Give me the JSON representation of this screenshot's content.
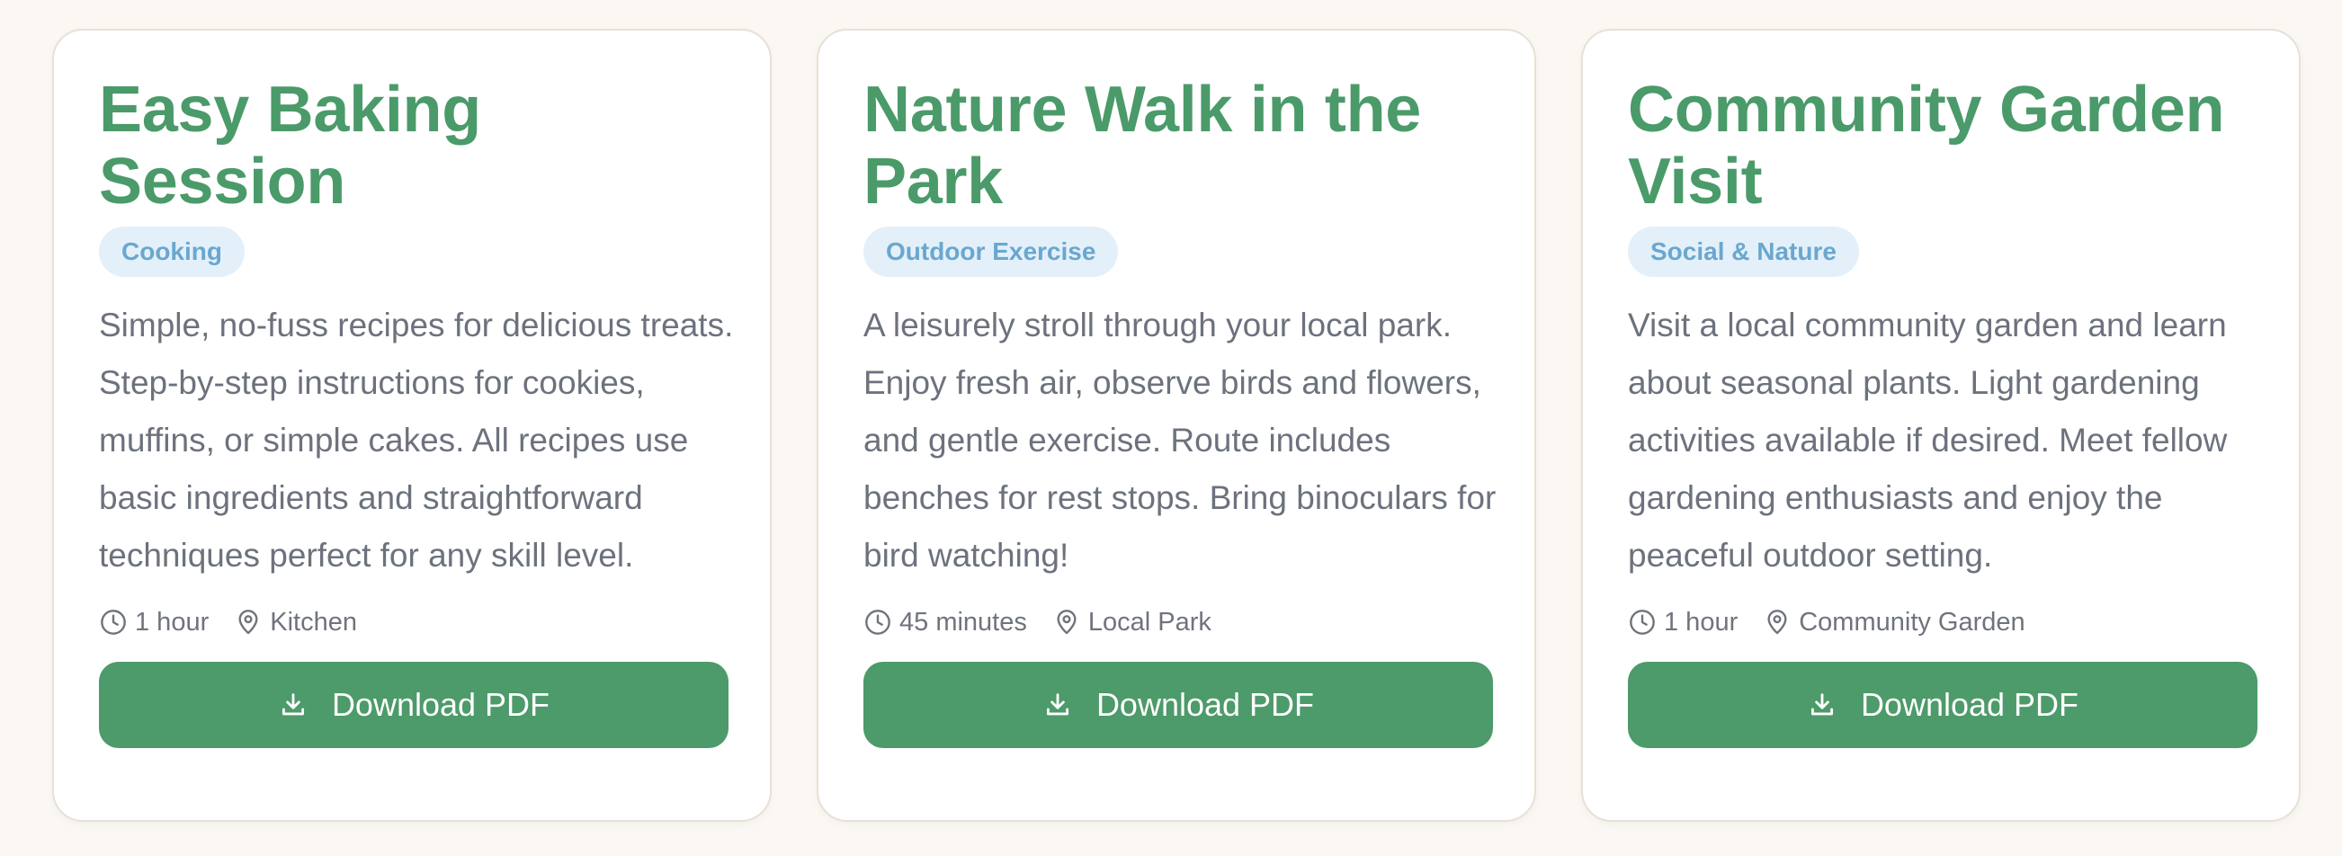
{
  "cards": [
    {
      "title": "Easy Baking Session",
      "badge": "Cooking",
      "description": "Simple, no-fuss recipes for delicious treats. Step-by-step instructions for cookies, muffins, or simple cakes. All recipes use basic ingredients and straightforward techniques perfect for any skill level.",
      "duration": "1 hour",
      "location": "Kitchen",
      "button_label": "Download PDF"
    },
    {
      "title": "Nature Walk in the Park",
      "badge": "Outdoor Exercise",
      "description": "A leisurely stroll through your local park. Enjoy fresh air, observe birds and flowers, and gentle exercise. Route includes benches for rest stops. Bring binoculars for bird watching!",
      "duration": "45 minutes",
      "location": "Local Park",
      "button_label": "Download PDF"
    },
    {
      "title": "Community Garden Visit",
      "badge": "Social & Nature",
      "description": "Visit a local community garden and learn about seasonal plants. Light gardening activities available if desired. Meet fellow gardening enthusiasts and enjoy the peaceful outdoor setting.",
      "duration": "1 hour",
      "location": "Community Garden",
      "button_label": "Download PDF"
    }
  ],
  "icons": {
    "duration": "clock-icon",
    "location": "map-pin-icon",
    "button": "download-icon"
  },
  "colors": {
    "background": "#fbf8f4",
    "title": "#4b9a6a",
    "badge_bg": "#e3f0f9",
    "badge_text": "#6aa7cf",
    "button": "#4d9a6a",
    "body_text": "#6c727d"
  }
}
